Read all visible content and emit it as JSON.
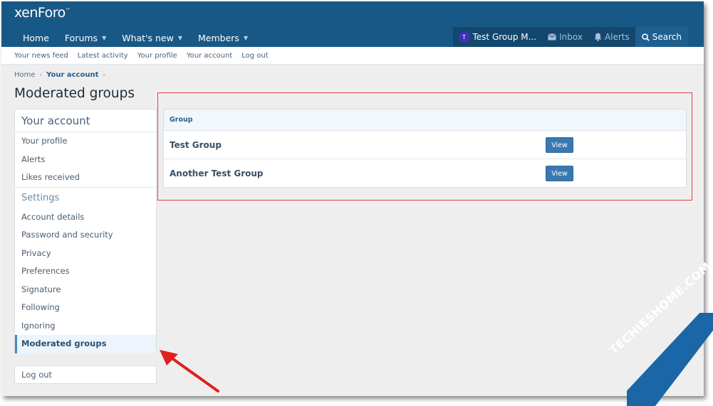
{
  "header": {
    "logo": "xenForo",
    "logo_tm": "™",
    "nav": [
      {
        "label": "Home",
        "has_menu": false
      },
      {
        "label": "Forums",
        "has_menu": true
      },
      {
        "label": "What's new",
        "has_menu": true
      },
      {
        "label": "Members",
        "has_menu": true
      }
    ],
    "user": {
      "avatar_letter": "T",
      "name": "Test Group M..."
    },
    "inbox": "Inbox",
    "alerts": "Alerts",
    "search": "Search"
  },
  "subnav": [
    "Your news feed",
    "Latest activity",
    "Your profile",
    "Your account",
    "Log out"
  ],
  "breadcrumb": {
    "home": "Home",
    "current": "Your account"
  },
  "page_title": "Moderated groups",
  "sidebar": {
    "title": "Your account",
    "items": [
      "Your profile",
      "Alerts",
      "Likes received"
    ],
    "settings_title": "Settings",
    "settings_items": [
      "Account details",
      "Password and security",
      "Privacy",
      "Preferences",
      "Signature",
      "Following",
      "Ignoring",
      "Moderated groups"
    ],
    "active": "Moderated groups",
    "logout": "Log out"
  },
  "groups": {
    "header": "Group",
    "rows": [
      {
        "name": "Test Group",
        "button": "View"
      },
      {
        "name": "Another Test Group",
        "button": "View"
      }
    ]
  },
  "watermark": "TECHIESHOME.COM",
  "colors": {
    "header_bg": "#185886",
    "button": "#3978b1",
    "highlight": "#e04040",
    "watermark": "#1a66a6"
  }
}
